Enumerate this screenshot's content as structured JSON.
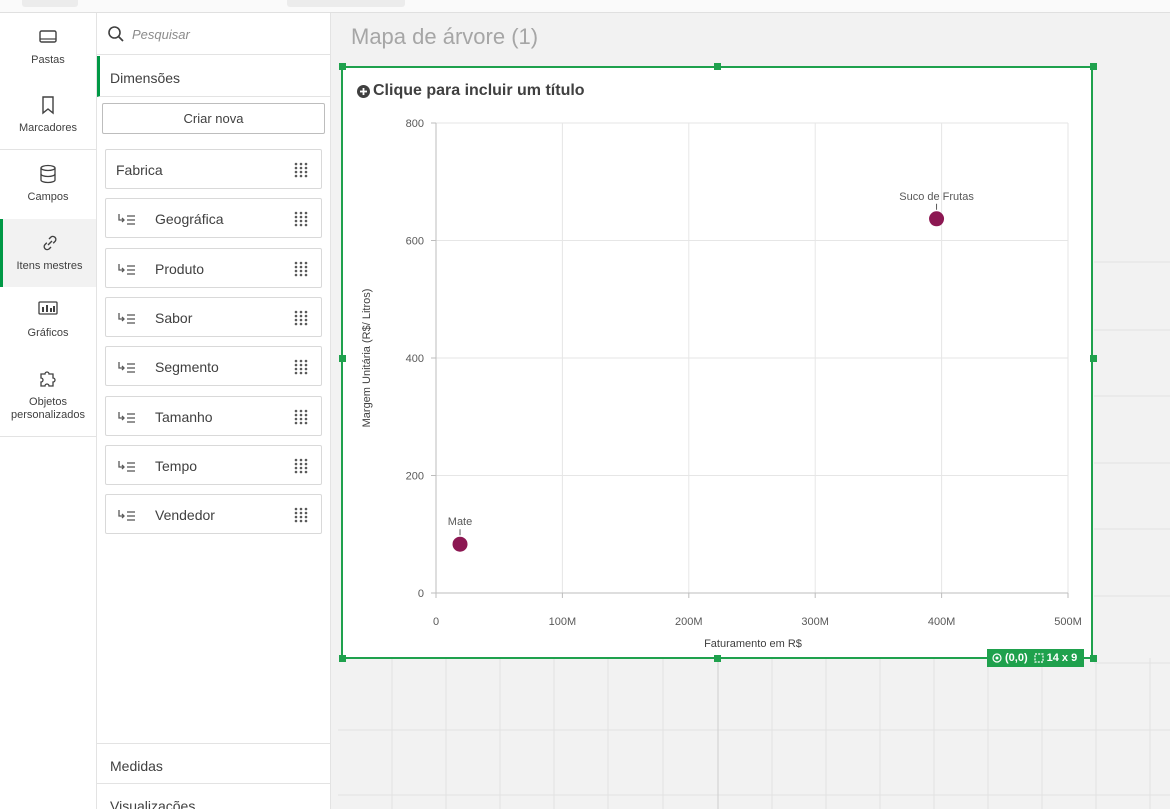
{
  "rail": {
    "items": [
      {
        "label": "Pastas",
        "icon": "sheet-icon"
      },
      {
        "label": "Marcadores",
        "icon": "bookmark-icon"
      },
      {
        "label": "Campos",
        "icon": "database-icon"
      },
      {
        "label": "Itens mestres",
        "icon": "link-icon",
        "active": true
      },
      {
        "label": "Gráficos",
        "icon": "bar-chart-icon"
      },
      {
        "label": "Objetos personalizados",
        "icon": "puzzle-icon"
      }
    ]
  },
  "panel": {
    "search_placeholder": "Pesquisar",
    "dimensions_label": "Dimensões",
    "create_label": "Criar nova",
    "dimensions": [
      "Fabrica",
      "Geográfica",
      "Produto",
      "Sabor",
      "Segmento",
      "Tamanho",
      "Tempo",
      "Vendedor"
    ],
    "measures_label": "Medidas",
    "visualizations_label": "Visualizações"
  },
  "sheet": {
    "title": "Mapa de árvore (1)"
  },
  "chart": {
    "add_title_label": "Clique para incluir um título",
    "accent_color": "#1fa14d",
    "point_color": "#8c1752",
    "badge_position": "(0,0)",
    "badge_size": "14 x 9"
  },
  "chart_data": {
    "type": "scatter",
    "title": "",
    "xlabel": "Faturamento em R$",
    "ylabel": "Margem Unitária (R$/ Litros)",
    "xlim": [
      0,
      500000000
    ],
    "ylim": [
      0,
      800
    ],
    "x_ticks": [
      0,
      100000000,
      200000000,
      300000000,
      400000000,
      500000000
    ],
    "x_tick_labels": [
      "0",
      "100M",
      "200M",
      "300M",
      "400M",
      "500M"
    ],
    "y_ticks": [
      0,
      200,
      400,
      600,
      800
    ],
    "y_tick_labels": [
      "0",
      "200",
      "400",
      "600",
      "800"
    ],
    "grid": true,
    "points": [
      {
        "label": "Mate",
        "x": 19000000,
        "y": 83
      },
      {
        "label": "Suco de Frutas",
        "x": 396000000,
        "y": 637
      }
    ]
  }
}
